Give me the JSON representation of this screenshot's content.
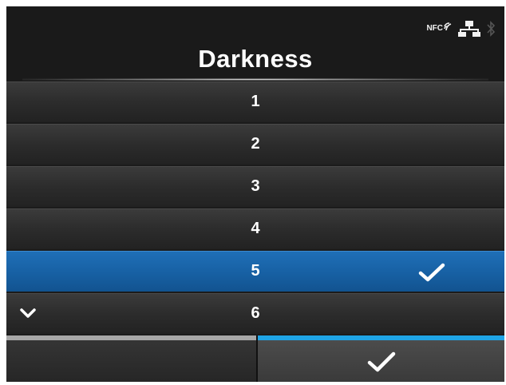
{
  "header": {
    "title": "Darkness"
  },
  "status_icons": {
    "nfc_label": "NFC",
    "icons": [
      "nfc-icon",
      "network-icon",
      "bluetooth-icon"
    ]
  },
  "list": {
    "items": [
      {
        "label": "1",
        "selected": false
      },
      {
        "label": "2",
        "selected": false
      },
      {
        "label": "3",
        "selected": false
      },
      {
        "label": "4",
        "selected": false
      },
      {
        "label": "5",
        "selected": true
      },
      {
        "label": "6",
        "selected": false
      }
    ],
    "selected_item_icon": "check-icon",
    "scroll_indicator_icon": "chevron-down-icon"
  },
  "footer": {
    "confirm_icon": "check-icon"
  },
  "colors": {
    "background": "#1b1b1b",
    "selected": "#1760a3",
    "accent": "#1fa4e6",
    "inactive_tab": "#a7a7a7",
    "text": "#ffffff"
  }
}
